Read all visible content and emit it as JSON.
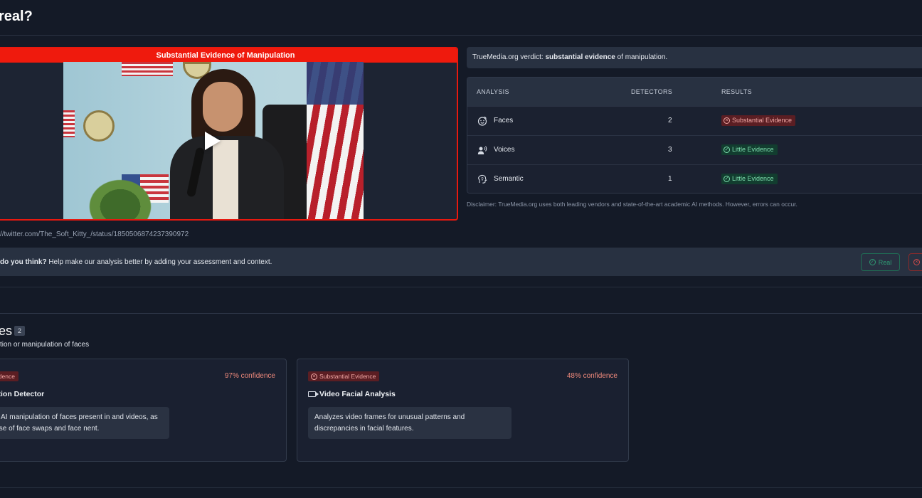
{
  "page": {
    "title": "real?"
  },
  "media": {
    "banner": "Substantial Evidence of Manipulation",
    "source_url": "//twitter.com/The_Soft_Kitty_/status/1850506874237390972"
  },
  "verdict": {
    "prefix": "TrueMedia.org verdict: ",
    "strong": "substantial evidence",
    "suffix": " of manipulation."
  },
  "analysis": {
    "headers": {
      "analysis": "ANALYSIS",
      "detectors": "DETECTORS",
      "results": "RESULTS"
    },
    "rows": [
      {
        "label": "Faces",
        "icon": "face-icon",
        "count": "2",
        "result": "Substantial Evidence",
        "status": "red"
      },
      {
        "label": "Voices",
        "icon": "voice-icon",
        "count": "3",
        "result": "Little Evidence",
        "status": "green"
      },
      {
        "label": "Semantic",
        "icon": "semantic-icon",
        "count": "1",
        "result": "Little Evidence",
        "status": "green"
      }
    ],
    "disclaimer": "Disclaimer: TrueMedia.org uses both leading vendors and state-of-the-art academic AI methods. However, errors can occur."
  },
  "feedback": {
    "strong": "do you think?",
    "text": " Help make our analysis better by adding your assessment and context.",
    "real_label": "Real"
  },
  "section": {
    "title": "es",
    "count": "2",
    "subtitle": "tion or manipulation of faces"
  },
  "detectors": [
    {
      "badge": "ntial Evidence",
      "confidence": "97% confidence",
      "name": "Manipulation Detector",
      "description": "potential AI manipulation of faces present in and videos, as in the case of face swaps and face nent."
    },
    {
      "badge": "Substantial Evidence",
      "confidence": "48% confidence",
      "name": "Video Facial Analysis",
      "description": "Analyzes video frames for unusual patterns and discrepancies in facial features."
    }
  ],
  "colors": {
    "manipulation_red": "#ef1a0d",
    "background": "#141a27",
    "panel": "#283141",
    "green_badge": "#123d2f",
    "red_badge": "#5b1e23"
  }
}
